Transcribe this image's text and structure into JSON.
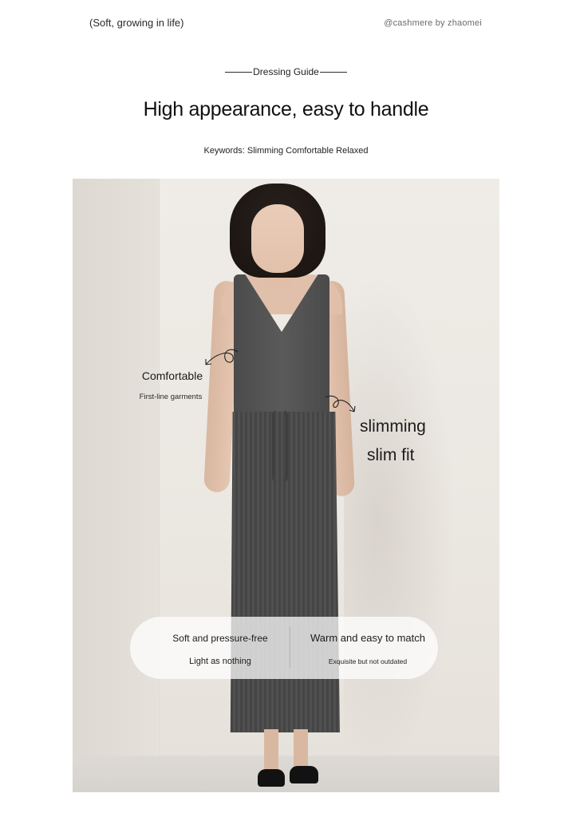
{
  "header": {
    "tagline": "(Soft, growing in life)",
    "handle": "@cashmere by zhaomei"
  },
  "section": {
    "label": "Dressing Guide",
    "headline": "High appearance, easy to handle",
    "keywords": "Keywords: Slimming Comfortable Relaxed"
  },
  "annotations": {
    "comfortable_title": "Comfortable",
    "comfortable_sub": "First-line garments",
    "slimming_line1": "slimming",
    "slimming_line2": "slim fit"
  },
  "features": {
    "left_title": "Soft and pressure-free",
    "left_sub": "Light as nothing",
    "right_title": "Warm and easy to match",
    "right_sub": "Exquisite but not outdated"
  },
  "colors": {
    "background": "#ffffff",
    "garment": "#4f4f4f",
    "text": "#1b1b1b"
  }
}
